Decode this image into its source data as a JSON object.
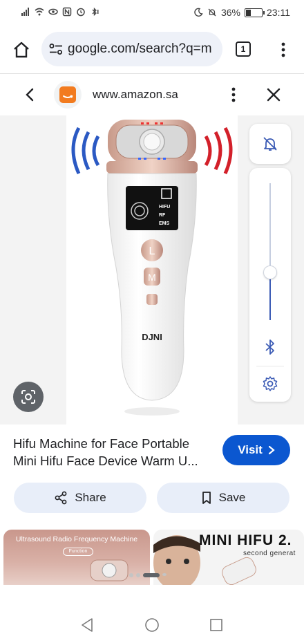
{
  "status_bar": {
    "battery_text": "36%",
    "battery_level": 0.36,
    "time": "23:11"
  },
  "browser": {
    "url": "google.com/search?q=m",
    "tab_count": "1",
    "icons": [
      "home-icon",
      "site-settings-icon",
      "tab-switcher-icon",
      "more-vert-icon"
    ]
  },
  "site_header": {
    "domain": "www.amazon.sa",
    "favicon_color": "#f27b1f"
  },
  "product": {
    "device_brand": "DJNI",
    "screen_labels": [
      "HIFU",
      "RF",
      "EMS"
    ],
    "button_letters": [
      "L",
      "M"
    ]
  },
  "volume": {
    "level": 0.35,
    "accent": "#3b5bb5"
  },
  "result": {
    "title": "Hifu Machine for Face Portable Mini Hifu Face Device Warm U...",
    "visit_label": "Visit",
    "visit_color": "#0b57d0",
    "share_label": "Share",
    "save_label": "Save"
  },
  "related": [
    {
      "caption": "Ultrasound Radio Frequency Machine",
      "sub": "Function"
    },
    {
      "caption": "MINI HIFU 2.",
      "sub": "second generat"
    }
  ],
  "pager": {
    "active_index": 2,
    "count": 4
  }
}
